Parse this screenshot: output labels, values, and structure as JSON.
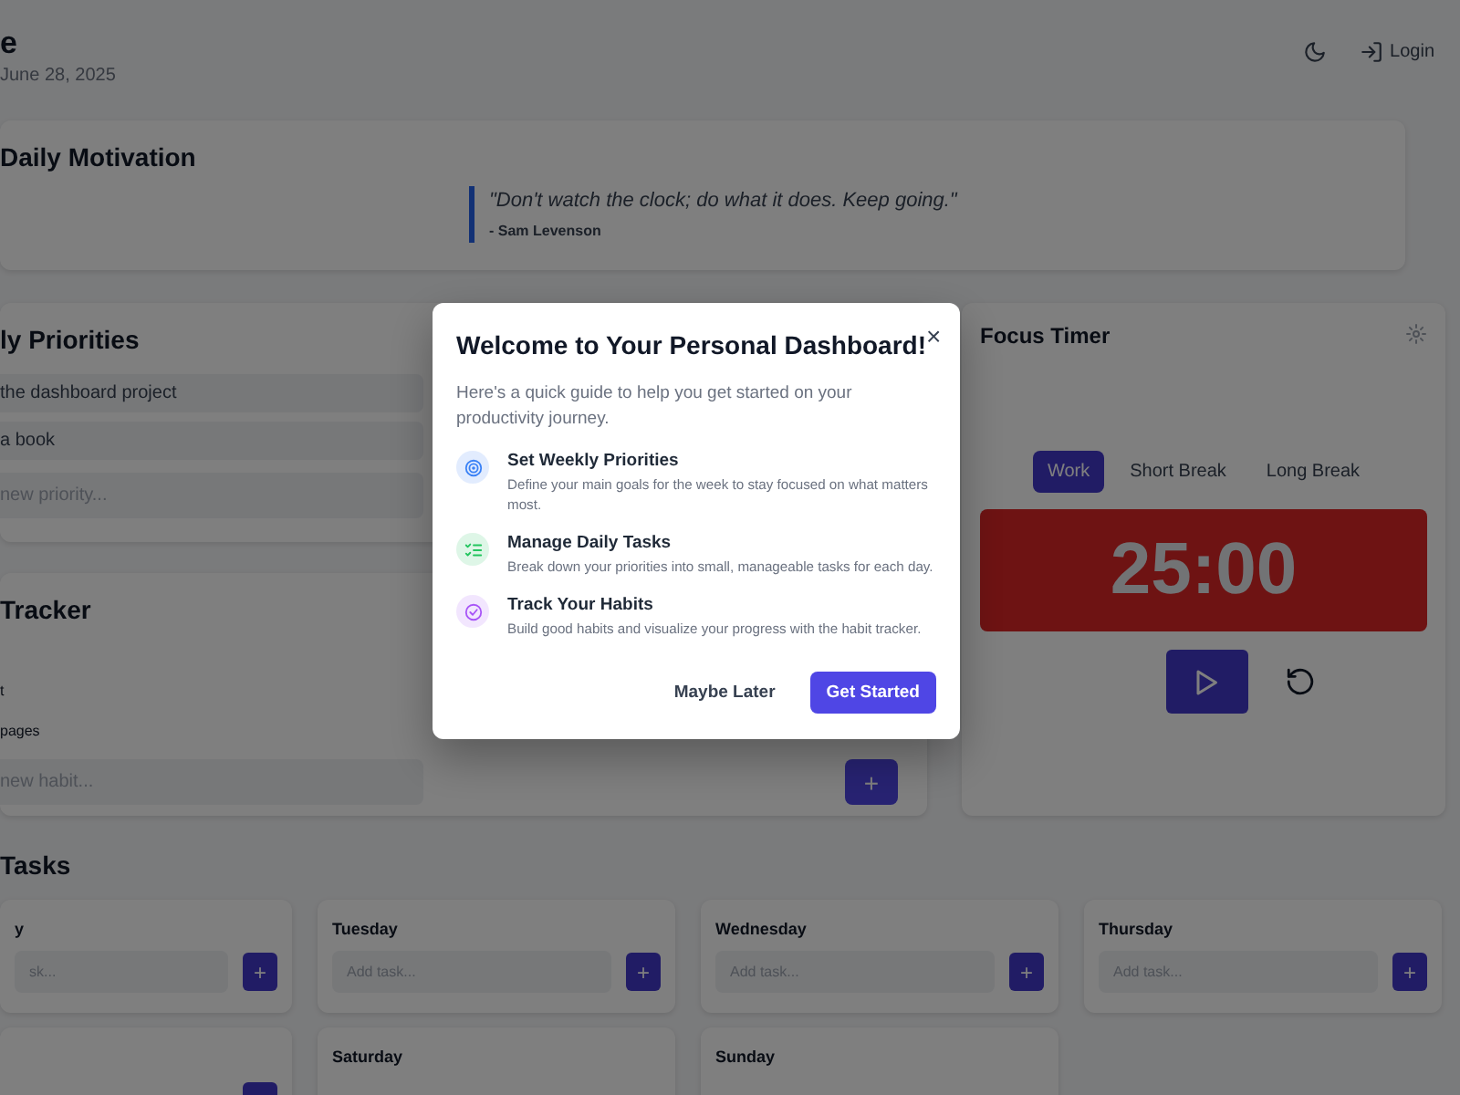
{
  "header": {
    "title": "e",
    "date": "June 28, 2025",
    "login": "Login"
  },
  "motivation": {
    "title": "Daily Motivation",
    "quote": "\"Don't watch the clock; do what it does. Keep going.\"",
    "author": "- Sam Levenson"
  },
  "priorities": {
    "title": "ly Priorities",
    "items": [
      "the dashboard project",
      "a book"
    ],
    "input": {
      "placeholder": "new priority..."
    }
  },
  "habits": {
    "title": "Tracker",
    "items": [
      "t",
      "pages"
    ],
    "input": {
      "placeholder": "new habit..."
    },
    "add": "+"
  },
  "timer": {
    "title": "Focus Timer",
    "modes": [
      {
        "label": "Work",
        "selected": true
      },
      {
        "label": "Short Break",
        "selected": false
      },
      {
        "label": "Long Break",
        "selected": false
      }
    ],
    "time": "25:00"
  },
  "tasks": {
    "title": "Tasks",
    "days": [
      {
        "name": "y",
        "placeholder": "sk...",
        "add": "+"
      },
      {
        "name": "Tuesday",
        "placeholder": "Add task...",
        "add": "+"
      },
      {
        "name": "Wednesday",
        "placeholder": "Add task...",
        "add": "+"
      },
      {
        "name": "Thursday",
        "placeholder": "Add task...",
        "add": "+"
      },
      {
        "kind": "partial"
      },
      {
        "name": "Saturday"
      },
      {
        "name": "Sunday"
      }
    ]
  },
  "modal": {
    "title": "Welcome to Your Personal Dashboard!",
    "close": "×",
    "intro": "Here's a quick guide to help you get started on your productivity journey.",
    "features": [
      {
        "kind": "target",
        "color": "#3b82f6",
        "title": "Set Weekly Priorities",
        "text": "Define your main goals for the week to stay focused on what matters most."
      },
      {
        "kind": "list",
        "color": "#22c55e",
        "title": "Manage Daily Tasks",
        "text": "Break down your priorities into small, manageable tasks for each day."
      },
      {
        "kind": "check",
        "color": "#a855f7",
        "title": "Track Your Habits",
        "text": "Build good habits and visualize your progress with the habit tracker."
      }
    ],
    "buttons": [
      {
        "kind": "secondary",
        "label": "Maybe Later"
      },
      {
        "kind": "primary",
        "label": "Get Started"
      }
    ]
  }
}
